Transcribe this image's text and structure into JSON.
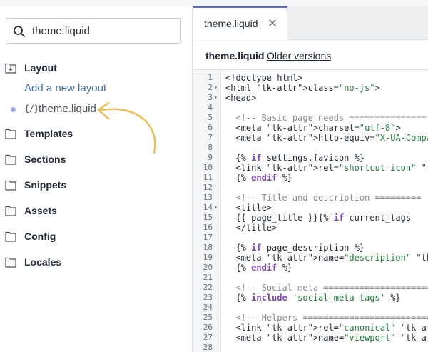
{
  "sidebar": {
    "search": {
      "value": "theme.liquid",
      "placeholder": ""
    },
    "folders": [
      {
        "label": "Layout"
      },
      {
        "label": "Templates"
      },
      {
        "label": "Sections"
      },
      {
        "label": "Snippets"
      },
      {
        "label": "Assets"
      },
      {
        "label": "Config"
      },
      {
        "label": "Locales"
      }
    ],
    "add_layout_label": "Add a new layout",
    "file_icon": "{/}",
    "file_name": "theme.liquid"
  },
  "editor": {
    "tab_label": "theme.liquid",
    "close_glyph": "×",
    "file_title": "theme.liquid",
    "older_versions_label": "Older versions",
    "lines": [
      {
        "n": "1",
        "fold": "",
        "code": "<!doctype html>"
      },
      {
        "n": "2",
        "fold": "▾",
        "code": "<html class=\"no-js\">"
      },
      {
        "n": "3",
        "fold": "▾",
        "code": "<head>"
      },
      {
        "n": "4",
        "fold": "",
        "code": ""
      },
      {
        "n": "5",
        "fold": "",
        "code": "  <!-- Basic page needs ==============="
      },
      {
        "n": "6",
        "fold": "",
        "code": "  <meta charset=\"utf-8\">"
      },
      {
        "n": "7",
        "fold": "",
        "code": "  <meta http-equiv=\"X-UA-Compatible\""
      },
      {
        "n": "8",
        "fold": "",
        "code": ""
      },
      {
        "n": "9",
        "fold": "",
        "code": "  {% if settings.favicon %}"
      },
      {
        "n": "10",
        "fold": "",
        "code": "  <link rel=\"shortcut icon\" href=\"{{"
      },
      {
        "n": "11",
        "fold": "",
        "code": "  {% endif %}"
      },
      {
        "n": "12",
        "fold": "",
        "code": ""
      },
      {
        "n": "13",
        "fold": "",
        "code": "  <!-- Title and description ========="
      },
      {
        "n": "14",
        "fold": "▾",
        "code": "  <title>"
      },
      {
        "n": "15",
        "fold": "",
        "code": "  {{ page_title }}{% if current_tags"
      },
      {
        "n": "16",
        "fold": "",
        "code": "  </title>"
      },
      {
        "n": "17",
        "fold": "",
        "code": ""
      },
      {
        "n": "18",
        "fold": "",
        "code": "  {% if page_description %}"
      },
      {
        "n": "19",
        "fold": "",
        "code": "  <meta name=\"description\" content=\"{"
      },
      {
        "n": "20",
        "fold": "",
        "code": "  {% endif %}"
      },
      {
        "n": "21",
        "fold": "",
        "code": ""
      },
      {
        "n": "22",
        "fold": "",
        "code": "  <!-- Social meta ====================="
      },
      {
        "n": "23",
        "fold": "",
        "code": "  {% include 'social-meta-tags' %}"
      },
      {
        "n": "24",
        "fold": "",
        "code": ""
      },
      {
        "n": "25",
        "fold": "",
        "code": "  <!-- Helpers ========================="
      },
      {
        "n": "26",
        "fold": "",
        "code": "  <link rel=\"canonical\" href=\"{{ cano"
      },
      {
        "n": "27",
        "fold": "",
        "code": "  <meta name=\"viewport\" content=\"widt"
      },
      {
        "n": "28",
        "fold": "",
        "code": ""
      }
    ]
  },
  "colors": {
    "accent": "#5c6ac4",
    "link": "#3f6fb3",
    "annotation_arrow": "#f6b94a"
  },
  "icons": [
    "search-icon",
    "folder-icon",
    "folder-download-icon",
    "close-icon",
    "liquid-file-icon",
    "fold-arrow-icon"
  ]
}
